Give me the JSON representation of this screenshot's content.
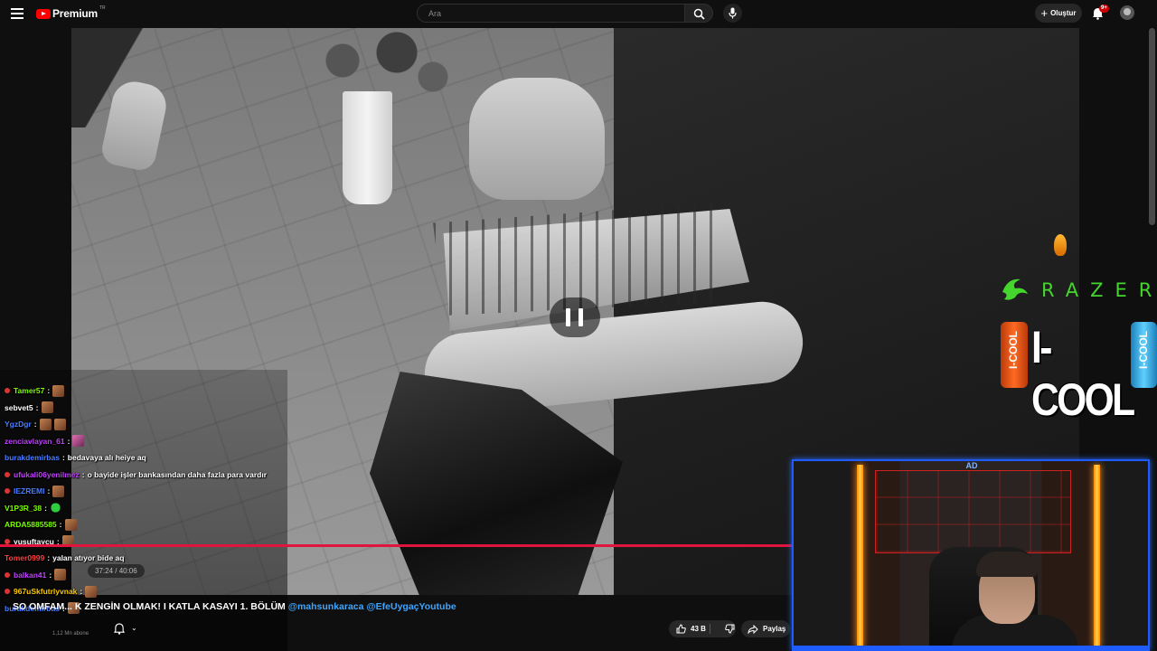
{
  "header": {
    "logo_text": "Premium",
    "logo_tm": "TR",
    "search_placeholder": "Ara",
    "create_label": "Oluştur",
    "notifications_badge": "9+"
  },
  "player": {
    "time": "37:24 / 40:06",
    "progress_fraction": 0.93,
    "state": "paused"
  },
  "overlay": {
    "sponsor_razer": "RAZER",
    "sponsor_icool": "I-COOL",
    "can_text": "I-COOL"
  },
  "chat": [
    {
      "user": "Tamer57",
      "color": "#7cfc00",
      "badge": true,
      "text": "",
      "emote": "face"
    },
    {
      "user": "sebvet5",
      "color": "#ffffff",
      "badge": false,
      "text": "",
      "emote": "face"
    },
    {
      "user": "YgzDgr",
      "color": "#4a7dff",
      "badge": false,
      "text": "",
      "emote": "face2"
    },
    {
      "user": "zenciavlayan_61",
      "color": "#c040ff",
      "badge": false,
      "text": "",
      "emote": "pink"
    },
    {
      "user": "burakdemirbas",
      "color": "#4a7dff",
      "badge": false,
      "text": "bedavaya alı heiye aq",
      "emote": ""
    },
    {
      "user": "ufukali06yenilmez",
      "color": "#c040ff",
      "badge": true,
      "text": "o bayide işler bankasından daha fazla para vardır",
      "emote": ""
    },
    {
      "user": "IEZREMI",
      "color": "#4a7dff",
      "badge": true,
      "text": "",
      "emote": "face"
    },
    {
      "user": "V1P3R_38",
      "color": "#7cfc00",
      "badge": false,
      "text": "",
      "emote": "green"
    },
    {
      "user": "ARDA5885585",
      "color": "#7cfc00",
      "badge": false,
      "text": "",
      "emote": "face"
    },
    {
      "user": "yusuftaycu",
      "color": "#ffffff",
      "badge": true,
      "text": "",
      "emote": "face"
    },
    {
      "user": "Tomer0999",
      "color": "#ff4040",
      "badge": false,
      "text": "yalan atıyor bide aq",
      "emote": ""
    },
    {
      "user": "balkan41",
      "color": "#c040ff",
      "badge": true,
      "text": "",
      "emote": "face"
    },
    {
      "user": "967uSkfutrlyvnak",
      "color": "#ffcc00",
      "badge": true,
      "text": "",
      "emote": "face"
    },
    {
      "user": "burakdemirbas",
      "color": "#4a7dff",
      "badge": false,
      "text": "",
      "emote": "face"
    }
  ],
  "video": {
    "title_prefix": "SO OMFAM... K ZENGİN OLMAK! I KATLA KASAYI 1. BÖLÜM",
    "mention1": "@mahsunkaraca",
    "mention2": "@EfeUygaçYoutube",
    "likes": "43 B",
    "share_label": "Paylaş",
    "subscribers": "1,12 Mn abone"
  },
  "colors": {
    "accent": "#e0143c",
    "youtube_red": "#ff0000",
    "razer_green": "#44d62c",
    "webcam_border": "#1e5cff"
  }
}
